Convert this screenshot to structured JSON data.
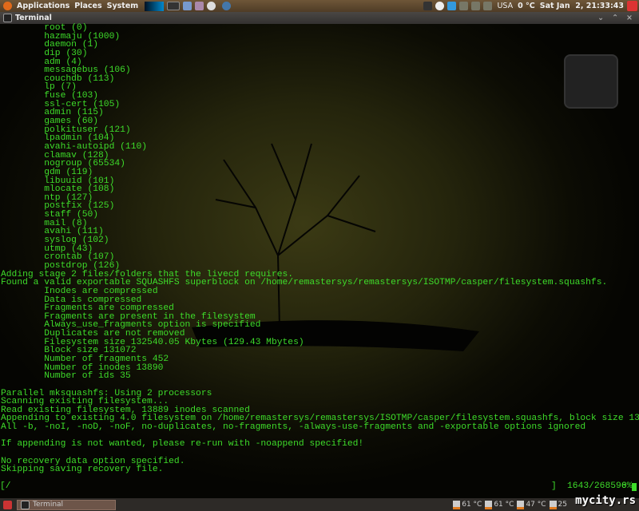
{
  "top_panel": {
    "menus": [
      "Applications",
      "Places",
      "System"
    ],
    "keyboard": "USA",
    "weather": "0 °C",
    "clock": "Sat Jan  2, 21:33:43"
  },
  "window": {
    "title": "Terminal"
  },
  "terminal": {
    "lines": [
      "        root (0)",
      "        hazmaju (1000)",
      "        daemon (1)",
      "        dip (30)",
      "        adm (4)",
      "        messagebus (106)",
      "        couchdb (113)",
      "        lp (7)",
      "        fuse (103)",
      "        ssl-cert (105)",
      "        admin (115)",
      "        games (60)",
      "        polkituser (121)",
      "        lpadmin (104)",
      "        avahi-autoipd (110)",
      "        clamav (128)",
      "        nogroup (65534)",
      "        gdm (119)",
      "        libuuid (101)",
      "        mlocate (108)",
      "        ntp (127)",
      "        postfix (125)",
      "        staff (50)",
      "        mail (8)",
      "        avahi (111)",
      "        syslog (102)",
      "        utmp (43)",
      "        crontab (107)",
      "        postdrop (126)",
      "Adding stage 2 files/folders that the livecd requires.",
      "Found a valid exportable SQUASHFS superblock on /home/remastersys/remastersys/ISOTMP/casper/filesystem.squashfs.",
      "        Inodes are compressed",
      "        Data is compressed",
      "        Fragments are compressed",
      "        Fragments are present in the filesystem",
      "        Always_use_fragments option is specified",
      "        Duplicates are not removed",
      "        Filesystem size 132540.05 Kbytes (129.43 Mbytes)",
      "        Block size 131072",
      "        Number of fragments 452",
      "        Number of inodes 13890",
      "        Number of ids 35",
      "",
      "Parallel mksquashfs: Using 2 processors",
      "Scanning existing filesystem...",
      "Read existing filesystem, 13889 inodes scanned",
      "Appending to existing 4.0 filesystem on /home/remastersys/remastersys/ISOTMP/casper/filesystem.squashfs, block size 131072",
      "All -b, -noI, -noD, -noF, no-duplicates, no-fragments, -always-use-fragments and -exportable options ignored",
      "",
      "If appending is not wanted, please re-run with -noappend specified!",
      "",
      "No recovery data option specified.",
      "Skipping saving recovery file."
    ],
    "progress_left": "[/",
    "progress_right": "]",
    "progress_count": "1643/268596",
    "progress_percent": "0%"
  },
  "bottom_panel": {
    "task": "Terminal",
    "temps": [
      "61 °C",
      "61 °C",
      "47 °C",
      "25"
    ]
  },
  "watermark": "mycity.rs",
  "colors": {
    "terminal_text": "#3edc2a",
    "panel": "#5e4930"
  }
}
